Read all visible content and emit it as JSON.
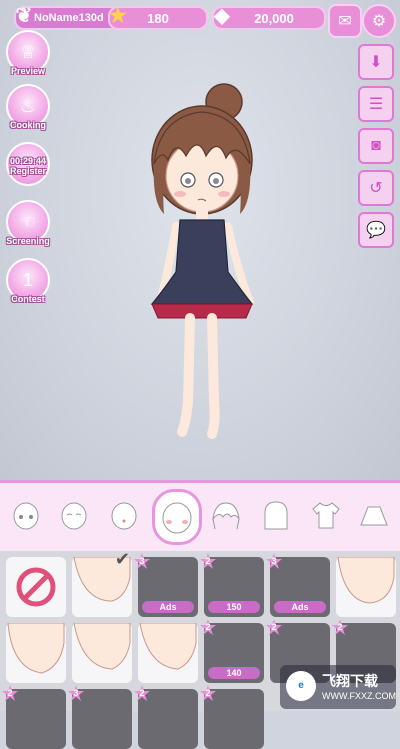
{
  "topbar": {
    "player_name": "NoName130d",
    "stars": "180",
    "gems": "20,000"
  },
  "left_menu": [
    {
      "label": "Preview",
      "icon": "dress-icon"
    },
    {
      "label": "Cooking",
      "icon": "pot-icon"
    },
    {
      "label": "Register",
      "icon": "exclamation-icon",
      "timer": "00:29:44"
    },
    {
      "label": "Screening",
      "icon": "hand-icon"
    },
    {
      "label": "Contest",
      "icon": "trophy-icon"
    }
  ],
  "right_menu": [
    "download-icon",
    "list-icon",
    "camera-icon",
    "undo-icon",
    "speech-bubble-icon"
  ],
  "tabs": [
    "eyes",
    "face-shape",
    "mouth",
    "cheeks",
    "hair-front",
    "hair-back",
    "top",
    "skirt"
  ],
  "active_tab": 3,
  "items": [
    {
      "badge": "",
      "tag": "",
      "dark": false
    },
    {
      "badge": "",
      "tag": "",
      "dark": false
    },
    {
      "badge": "3",
      "tag": "Ads",
      "dark": true
    },
    {
      "badge": "2",
      "tag": "150",
      "dark": true
    },
    {
      "badge": "3",
      "tag": "Ads",
      "dark": true
    },
    {
      "badge": "2",
      "tag": "",
      "dark": true
    },
    {
      "badge": "",
      "tag": "",
      "dark": false
    },
    {
      "badge": "",
      "tag": "",
      "dark": false
    },
    {
      "badge": "",
      "tag": "",
      "dark": false
    },
    {
      "badge": "2",
      "tag": "140",
      "dark": true
    },
    {
      "badge": "2",
      "tag": "",
      "dark": true
    },
    {
      "badge": "2",
      "tag": "",
      "dark": true
    },
    {
      "badge": "2",
      "tag": "",
      "dark": true
    },
    {
      "badge": "3",
      "tag": "",
      "dark": true
    },
    {
      "badge": "2",
      "tag": "",
      "dark": true
    },
    {
      "badge": "2",
      "tag": "",
      "dark": true
    }
  ],
  "watermark": {
    "text": "飞翔下载",
    "url": "WWW.FXXZ.COM"
  }
}
